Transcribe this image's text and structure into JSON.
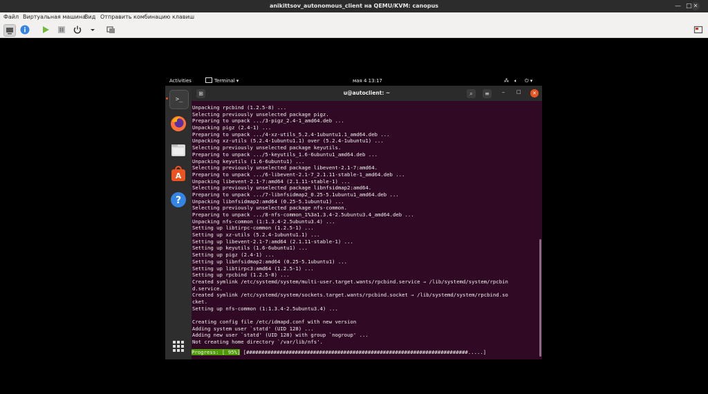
{
  "window": {
    "title": "anikittsov_autonomous_client на QEMU/KVM: canopus"
  },
  "menu": {
    "items": [
      "Файл",
      "Виртуальная машина",
      "Вид",
      "Отправить комбинацию клавиш"
    ]
  },
  "toolbar": {
    "icons": [
      "console-icon",
      "info-icon",
      "play-icon",
      "pause-icon",
      "power-icon",
      "dropdown-icon",
      "screenshot-icon",
      "fullscreen-icon"
    ]
  },
  "gnome": {
    "activities": "Activities",
    "app_menu": "Terminal ▾",
    "clock": "мая 4  13:17"
  },
  "terminal": {
    "title": "u@autoclient: ~",
    "lines": [
      "Unpacking rpcbind (1.2.5-8) ...",
      "Selecting previously unselected package pigz.",
      "Preparing to unpack .../3-pigz_2.4-1_amd64.deb ...",
      "Unpacking pigz (2.4-1) ...",
      "Preparing to unpack .../4-xz-utils_5.2.4-1ubuntu1.1_amd64.deb ...",
      "Unpacking xz-utils (5.2.4-1ubuntu1.1) over (5.2.4-1ubuntu1) ...",
      "Selecting previously unselected package keyutils.",
      "Preparing to unpack .../5-keyutils_1.6-6ubuntu1_amd64.deb ...",
      "Unpacking keyutils (1.6-6ubuntu1) ...",
      "Selecting previously unselected package libevent-2.1-7:amd64.",
      "Preparing to unpack .../6-libevent-2.1-7_2.1.11-stable-1_amd64.deb ...",
      "Unpacking libevent-2.1-7:amd64 (2.1.11-stable-1) ...",
      "Selecting previously unselected package libnfsidmap2:amd64.",
      "Preparing to unpack .../7-libnfsidmap2_0.25-5.1ubuntu1_amd64.deb ...",
      "Unpacking libnfsidmap2:amd64 (0.25-5.1ubuntu1) ...",
      "Selecting previously unselected package nfs-common.",
      "Preparing to unpack .../8-nfs-common_1%3a1.3.4-2.5ubuntu3.4_amd64.deb ...",
      "Unpacking nfs-common (1:1.3.4-2.5ubuntu3.4) ...",
      "Setting up libtirpc-common (1.2.5-1) ...",
      "Setting up xz-utils (5.2.4-1ubuntu1.1) ...",
      "Setting up libevent-2.1-7:amd64 (2.1.11-stable-1) ...",
      "Setting up keyutils (1.6-6ubuntu1) ...",
      "Setting up pigz (2.4-1) ...",
      "Setting up libnfsidmap2:amd64 (0.25-5.1ubuntu1) ...",
      "Setting up libtirpc3:amd64 (1.2.5-1) ...",
      "Setting up rpcbind (1.2.5-8) ...",
      "Created symlink /etc/systemd/system/multi-user.target.wants/rpcbind.service → /lib/systemd/system/rpcbin",
      "d.service.",
      "Created symlink /etc/systemd/system/sockets.target.wants/rpcbind.socket → /lib/systemd/system/rpcbind.so",
      "cket.",
      "Setting up nfs-common (1:1.3.4-2.5ubuntu3.4) ...",
      "",
      "Creating config file /etc/idmapd.conf with new version",
      "Adding system user `statd' (UID 128) ...",
      "Adding new user `statd' (UID 128) with group `nogroup' ...",
      "Not creating home directory `/var/lib/nfs'."
    ],
    "progress_label": "Progress: [ 95%]",
    "progress_bar": "[#########################################################################.....]",
    "progress_percent": 95
  }
}
